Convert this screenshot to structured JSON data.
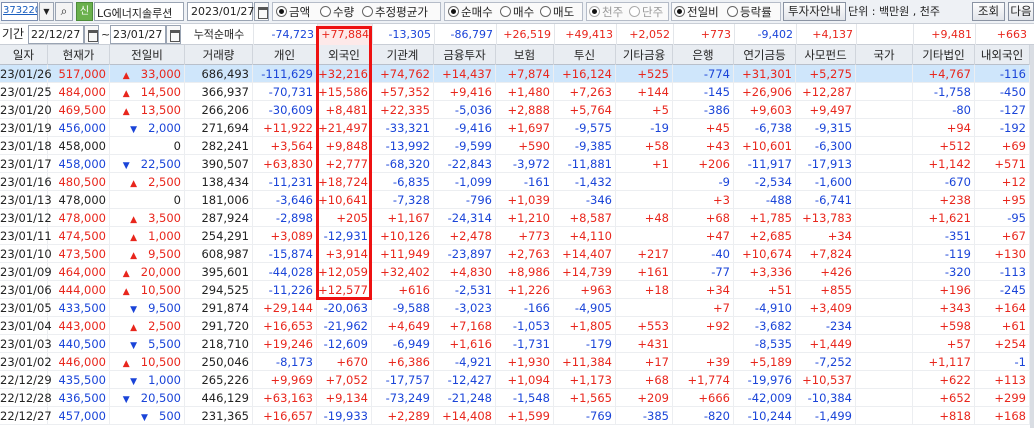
{
  "toolbar": {
    "stock_code": "373220",
    "new_badge": "신",
    "stock_name": "LG에너지솔루션",
    "date": "2023/01/27",
    "mode_options": [
      {
        "label": "금액",
        "selected": true
      },
      {
        "label": "수량",
        "selected": false
      },
      {
        "label": "추정평균가",
        "selected": false
      }
    ],
    "trade_options": [
      {
        "label": "순매수",
        "selected": true
      },
      {
        "label": "매수",
        "selected": false
      },
      {
        "label": "매도",
        "selected": false
      }
    ],
    "cycle_options": [
      {
        "label": "천주",
        "selected": true,
        "disabled": true
      },
      {
        "label": "단주",
        "selected": false,
        "disabled": true
      }
    ],
    "compare_options": [
      {
        "label": "전일비",
        "selected": true
      },
      {
        "label": "등락률",
        "selected": false
      }
    ],
    "investor_guide_label": "투자자안내",
    "unit_text": "단위 : 백만원 , 천주",
    "query_button": "조회",
    "next_button": "다음",
    "arrows": "◀▶"
  },
  "period": {
    "label": "기간",
    "from": "22/12/27",
    "tilde": "~",
    "to": "23/01/27",
    "cumulative_label": "누적순매수",
    "cumulative": [
      "-74,723",
      "+77,884",
      "-13,305",
      "-86,797",
      "+26,519",
      "+49,413",
      "+2,052",
      "+773",
      "-9,402",
      "+4,137",
      "",
      "+9,481",
      "+663"
    ]
  },
  "columns": [
    "일자",
    "현재가",
    "전일비",
    "거래량",
    "개인",
    "외국인",
    "기관계",
    "금융투자",
    "보험",
    "투신",
    "기타금융",
    "은행",
    "연기금등",
    "사모펀드",
    "국가",
    "기타법인",
    "내외국인"
  ],
  "rows": [
    [
      "23/01/26",
      "517,000",
      "up",
      "33,000",
      "686,493",
      "-111,629",
      "+32,216",
      "+74,762",
      "+14,437",
      "+7,874",
      "+16,124",
      "+525",
      "-774",
      "+31,301",
      "+5,275",
      "",
      "+4,767",
      "-116"
    ],
    [
      "23/01/25",
      "484,000",
      "up",
      "14,500",
      "366,937",
      "-70,731",
      "+15,586",
      "+57,352",
      "+9,416",
      "+1,480",
      "+7,263",
      "+144",
      "-145",
      "+26,906",
      "+12,287",
      "",
      "-1,758",
      "-450"
    ],
    [
      "23/01/20",
      "469,500",
      "up",
      "13,500",
      "266,206",
      "-30,609",
      "+8,481",
      "+22,335",
      "-5,036",
      "+2,888",
      "+5,764",
      "+5",
      "-386",
      "+9,603",
      "+9,497",
      "",
      "-80",
      "-127"
    ],
    [
      "23/01/19",
      "456,000",
      "down",
      "2,000",
      "271,694",
      "+11,922",
      "+21,497",
      "-33,321",
      "-9,416",
      "+1,697",
      "-9,575",
      "-19",
      "+45",
      "-6,738",
      "-9,315",
      "",
      "+94",
      "-192"
    ],
    [
      "23/01/18",
      "458,000",
      "flat",
      "0",
      "282,241",
      "+3,564",
      "+9,848",
      "-13,992",
      "-9,599",
      "+590",
      "-9,385",
      "+58",
      "+43",
      "+10,601",
      "-6,300",
      "",
      "+512",
      "+69"
    ],
    [
      "23/01/17",
      "458,000",
      "down",
      "22,500",
      "390,507",
      "+63,830",
      "+2,777",
      "-68,320",
      "-22,843",
      "-3,972",
      "-11,881",
      "+1",
      "+206",
      "-11,917",
      "-17,913",
      "",
      "+1,142",
      "+571"
    ],
    [
      "23/01/16",
      "480,500",
      "up",
      "2,500",
      "138,434",
      "-11,231",
      "+18,724",
      "-6,835",
      "-1,099",
      "-161",
      "-1,432",
      "",
      "-9",
      "-2,534",
      "-1,600",
      "",
      "-670",
      "+12"
    ],
    [
      "23/01/13",
      "478,000",
      "flat",
      "0",
      "181,006",
      "-3,646",
      "+10,641",
      "-7,328",
      "-796",
      "+1,039",
      "-346",
      "",
      "+3",
      "-488",
      "-6,741",
      "",
      "+238",
      "+95"
    ],
    [
      "23/01/12",
      "478,000",
      "up",
      "3,500",
      "287,924",
      "-2,898",
      "+205",
      "+1,167",
      "-24,314",
      "+1,210",
      "+8,587",
      "+48",
      "+68",
      "+1,785",
      "+13,783",
      "",
      "+1,621",
      "-95"
    ],
    [
      "23/01/11",
      "474,500",
      "up",
      "1,000",
      "254,291",
      "+3,089",
      "-12,931",
      "+10,126",
      "+2,478",
      "+773",
      "+4,110",
      "",
      "+47",
      "+2,685",
      "+34",
      "",
      "-351",
      "+67"
    ],
    [
      "23/01/10",
      "473,500",
      "up",
      "9,500",
      "608,987",
      "-15,874",
      "+3,914",
      "+11,949",
      "-23,897",
      "+2,763",
      "+14,407",
      "+217",
      "-40",
      "+10,674",
      "+7,824",
      "",
      "-119",
      "+130"
    ],
    [
      "23/01/09",
      "464,000",
      "up",
      "20,000",
      "395,601",
      "-44,028",
      "+12,059",
      "+32,402",
      "+4,830",
      "+8,986",
      "+14,739",
      "+161",
      "-77",
      "+3,336",
      "+426",
      "",
      "-320",
      "-113"
    ],
    [
      "23/01/06",
      "444,000",
      "up",
      "10,500",
      "294,525",
      "-11,226",
      "+12,577",
      "+616",
      "-2,531",
      "+1,226",
      "+963",
      "+18",
      "+34",
      "+51",
      "+855",
      "",
      "+196",
      "-245"
    ],
    [
      "23/01/05",
      "433,500",
      "down",
      "9,500",
      "291,874",
      "+29,144",
      "-20,063",
      "-9,588",
      "-3,023",
      "-166",
      "-4,905",
      "",
      "+7",
      "-4,910",
      "+3,409",
      "",
      "+343",
      "+164"
    ],
    [
      "23/01/04",
      "443,000",
      "up",
      "2,500",
      "291,720",
      "+16,653",
      "-21,962",
      "+4,649",
      "+7,168",
      "-1,053",
      "+1,805",
      "+553",
      "+92",
      "-3,682",
      "-234",
      "",
      "+598",
      "+61"
    ],
    [
      "23/01/03",
      "440,500",
      "down",
      "5,500",
      "218,710",
      "+19,246",
      "-12,609",
      "-6,949",
      "+1,616",
      "-1,731",
      "-179",
      "+431",
      "",
      "-8,535",
      "+1,449",
      "",
      "+57",
      "+254"
    ],
    [
      "23/01/02",
      "446,000",
      "up",
      "10,500",
      "250,046",
      "-8,173",
      "+670",
      "+6,386",
      "-4,921",
      "+1,930",
      "+11,384",
      "+17",
      "+39",
      "+5,189",
      "-7,252",
      "",
      "+1,117",
      "-1"
    ],
    [
      "22/12/29",
      "435,500",
      "down",
      "1,000",
      "265,226",
      "+9,969",
      "+7,052",
      "-17,757",
      "-12,427",
      "+1,094",
      "+1,173",
      "+68",
      "+1,774",
      "-19,976",
      "+10,537",
      "",
      "+622",
      "+113"
    ],
    [
      "22/12/28",
      "436,500",
      "down",
      "20,500",
      "446,129",
      "+63,163",
      "+9,134",
      "-73,249",
      "-21,248",
      "-1,548",
      "+1,565",
      "+209",
      "+666",
      "-42,009",
      "-10,384",
      "",
      "+652",
      "+299"
    ],
    [
      "22/12/27",
      "457,000",
      "down",
      "500",
      "231,365",
      "+16,657",
      "-19,933",
      "+2,289",
      "+14,408",
      "+1,599",
      "-769",
      "-385",
      "-820",
      "-10,244",
      "-1,499",
      "",
      "+818",
      "+168"
    ]
  ],
  "colors": {
    "positive": "#e8261c",
    "negative": "#1a44d8",
    "selected_row": "#cfe6fb",
    "highlight_box": "#ee1111"
  }
}
